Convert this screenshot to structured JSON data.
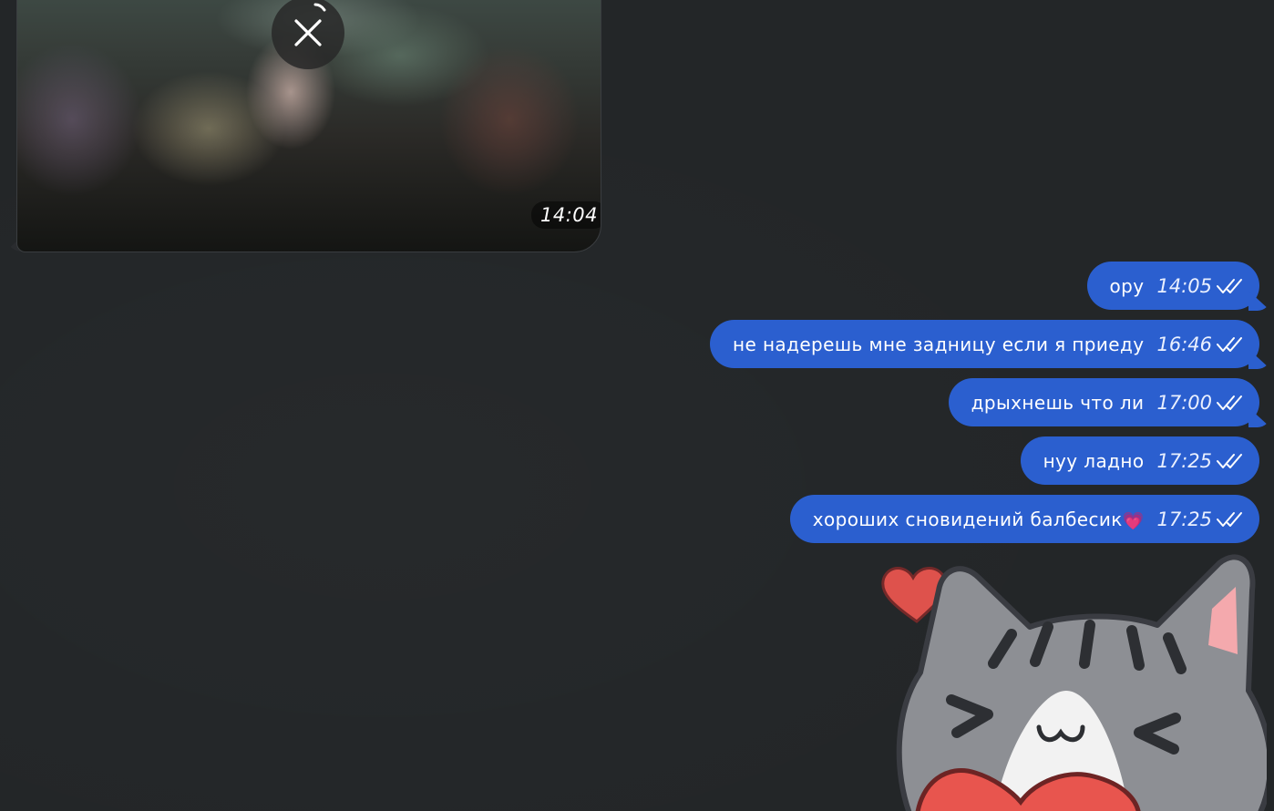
{
  "incoming_media": {
    "time": "14:04",
    "close_icon": "close-icon"
  },
  "outgoing_messages": [
    {
      "text": "ору",
      "time": "14:05",
      "status_icon": "double-check-icon"
    },
    {
      "text": "не надерешь мне задницу если я приеду",
      "time": "16:46",
      "status_icon": "double-check-icon"
    },
    {
      "text": "дрыхнешь что ли",
      "time": "17:00",
      "status_icon": "double-check-icon"
    },
    {
      "text": "нуу ладно",
      "time": "17:25",
      "status_icon": "double-check-icon"
    },
    {
      "text": "хороших сновидений балбесик",
      "emoji": "💗",
      "time": "17:25",
      "status_icon": "double-check-icon"
    }
  ],
  "sticker": {
    "icon": "cat-with-heart-sticker"
  },
  "colors": {
    "background": "#232628",
    "outgoing_bubble": "#2b5fcf",
    "heart": "#e8554e"
  }
}
